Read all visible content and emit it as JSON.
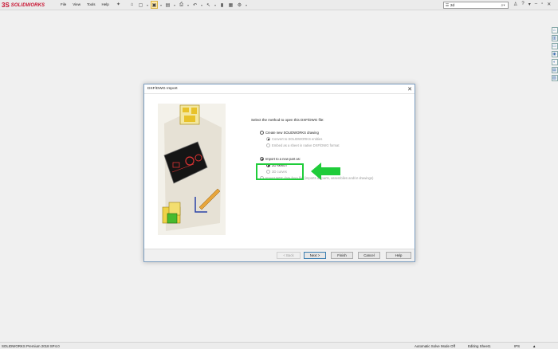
{
  "app": {
    "logo_mark": "3S",
    "logo_text": "SOLIDWORKS",
    "menu": [
      "File",
      "View",
      "Tools",
      "Help"
    ],
    "search_placeholder": "2d",
    "toolbar_icons": [
      "home-icon",
      "new-document-icon",
      "open-icon",
      "save-icon",
      "print-icon",
      "undo-icon",
      "select-icon",
      "rebuild-icon",
      "options-icon"
    ],
    "right_icons": [
      "user-icon",
      "help-icon",
      "minimize-icon",
      "restore-icon",
      "close-icon"
    ]
  },
  "dialog": {
    "title": "DXF/DWG Import",
    "close_glyph": "✕",
    "prompt": "Select the method to open this DXF/DWG file:",
    "options": {
      "create_drawing": "Create new SOLIDWORKS drawing",
      "convert_entities": "Convert to SOLIDWORKS entities",
      "embed_sheet": "Embed as a sheet in native DXF/DWG format",
      "import_part": "Import to a new part as:",
      "sketch_2d": "2D sketch",
      "sketch_3d": "3D curves",
      "import_mdt": "Import MDT data from file (imports as parts, assemblies and/or drawings)"
    },
    "buttons": {
      "back": "< Back",
      "next": "Next >",
      "finish": "Finish",
      "cancel": "Cancel",
      "help": "Help"
    }
  },
  "status": {
    "product": "SOLIDWORKS Premium 2018 SP4.0",
    "solve_mode": "Automatic Solve Mode Off",
    "editing": "Editing Sheet1",
    "units": "IPS"
  },
  "colors": {
    "highlight": "#1fcc3a",
    "brand": "#c8102e"
  }
}
